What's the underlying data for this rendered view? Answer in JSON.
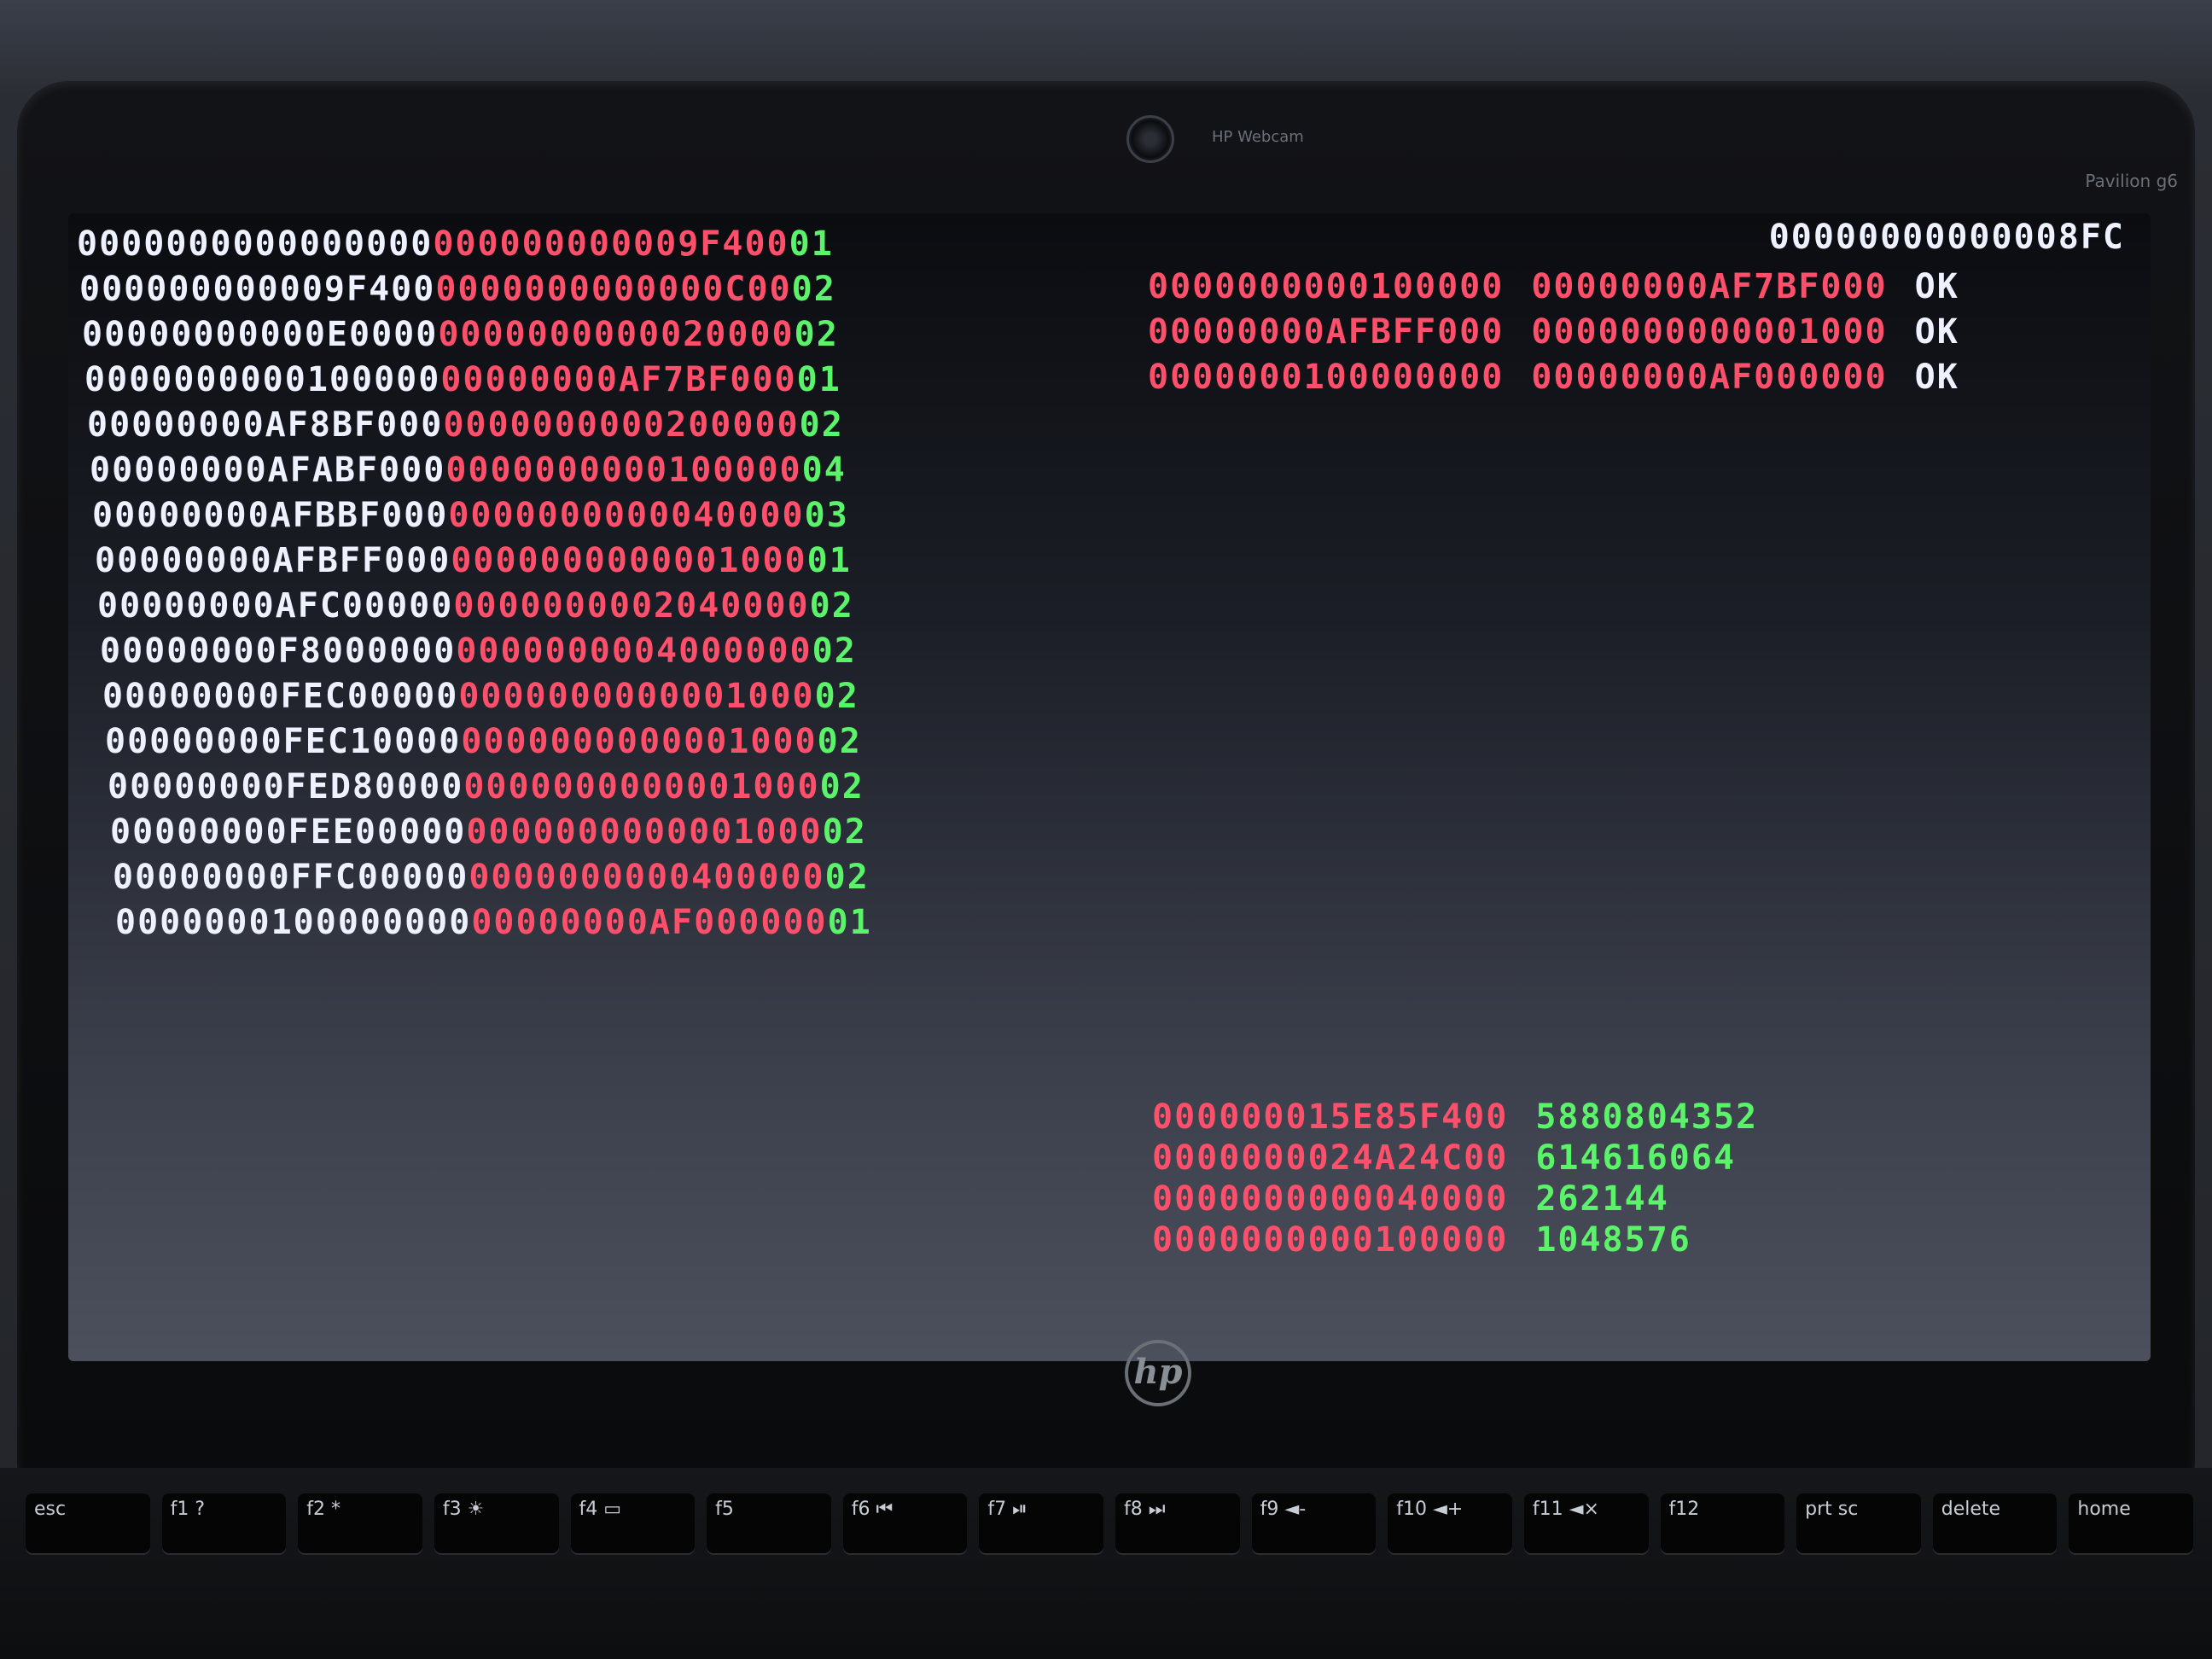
{
  "bezel": {
    "webcam_label": "HP Webcam",
    "model_label": "Pavilion g6",
    "logo_text": "hp"
  },
  "screen": {
    "memory_map": [
      {
        "base": "0000000000000000",
        "length": "000000000009F400",
        "type": "01"
      },
      {
        "base": "000000000009F400",
        "length": "0000000000000C00",
        "type": "02"
      },
      {
        "base": "00000000000E0000",
        "length": "0000000000020000",
        "type": "02"
      },
      {
        "base": "0000000000100000",
        "length": "00000000AF7BF000",
        "type": "01"
      },
      {
        "base": "00000000AF8BF000",
        "length": "0000000000200000",
        "type": "02"
      },
      {
        "base": "00000000AFABF000",
        "length": "0000000000100000",
        "type": "04"
      },
      {
        "base": "00000000AFBBF000",
        "length": "0000000000040000",
        "type": "03"
      },
      {
        "base": "00000000AFBFF000",
        "length": "0000000000001000",
        "type": "01"
      },
      {
        "base": "00000000AFC00000",
        "length": "0000000002040000",
        "type": "02"
      },
      {
        "base": "00000000F8000000",
        "length": "0000000004000000",
        "type": "02"
      },
      {
        "base": "00000000FEC00000",
        "length": "0000000000001000",
        "type": "02"
      },
      {
        "base": "00000000FEC10000",
        "length": "0000000000001000",
        "type": "02"
      },
      {
        "base": "00000000FED80000",
        "length": "0000000000001000",
        "type": "02"
      },
      {
        "base": "00000000FEE00000",
        "length": "0000000000001000",
        "type": "02"
      },
      {
        "base": "00000000FFC00000",
        "length": "0000000000400000",
        "type": "02"
      },
      {
        "base": "0000000100000000",
        "length": "00000000AF000000",
        "type": "01"
      }
    ],
    "summary_top": "00000000000008FC",
    "checks": [
      {
        "base": "0000000000100000",
        "length": "00000000AF7BF000",
        "status": "OK"
      },
      {
        "base": "00000000AFBFF000",
        "length": "0000000000001000",
        "status": "OK"
      },
      {
        "base": "0000000100000000",
        "length": "00000000AF000000",
        "status": "OK"
      }
    ],
    "totals": [
      {
        "hex": "000000015E85F400",
        "dec": "5880804352"
      },
      {
        "hex": "0000000024A24C00",
        "dec": "614616064"
      },
      {
        "hex": "0000000000040000",
        "dec": "262144"
      },
      {
        "hex": "0000000000100000",
        "dec": "1048576"
      }
    ]
  },
  "keyboard": {
    "keys": [
      "esc",
      "f1 ?",
      "f2 *",
      "f3 ☀",
      "f4 ▭",
      "f5",
      "f6 ⏮",
      "f7 ⏯",
      "f8 ⏭",
      "f9 ◄-",
      "f10 ◄+",
      "f11 ◄×",
      "f12",
      "prt sc",
      "delete",
      "home"
    ]
  },
  "colors": {
    "base_column": "#eef1ff",
    "length_column": "#ff4f6a",
    "type_column": "#5bf36a"
  }
}
